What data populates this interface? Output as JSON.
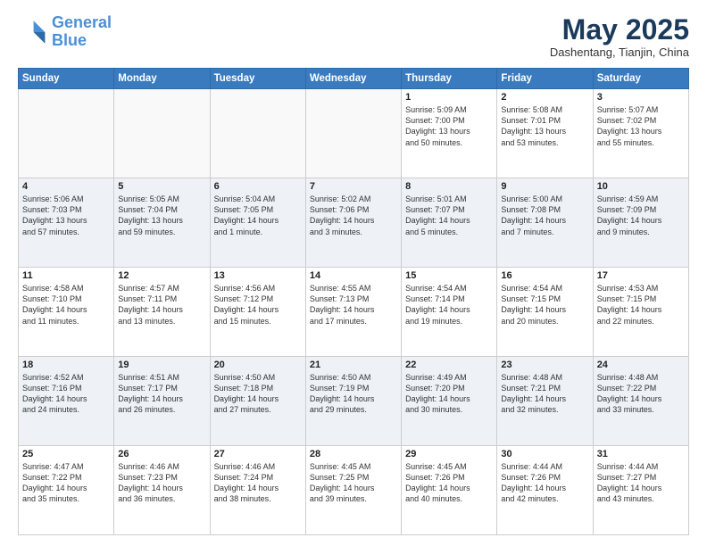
{
  "header": {
    "logo_line1": "General",
    "logo_line2": "Blue",
    "month": "May 2025",
    "location": "Dashentang, Tianjin, China"
  },
  "weekdays": [
    "Sunday",
    "Monday",
    "Tuesday",
    "Wednesday",
    "Thursday",
    "Friday",
    "Saturday"
  ],
  "weeks": [
    [
      {
        "day": "",
        "content": ""
      },
      {
        "day": "",
        "content": ""
      },
      {
        "day": "",
        "content": ""
      },
      {
        "day": "",
        "content": ""
      },
      {
        "day": "1",
        "content": "Sunrise: 5:09 AM\nSunset: 7:00 PM\nDaylight: 13 hours\nand 50 minutes."
      },
      {
        "day": "2",
        "content": "Sunrise: 5:08 AM\nSunset: 7:01 PM\nDaylight: 13 hours\nand 53 minutes."
      },
      {
        "day": "3",
        "content": "Sunrise: 5:07 AM\nSunset: 7:02 PM\nDaylight: 13 hours\nand 55 minutes."
      }
    ],
    [
      {
        "day": "4",
        "content": "Sunrise: 5:06 AM\nSunset: 7:03 PM\nDaylight: 13 hours\nand 57 minutes."
      },
      {
        "day": "5",
        "content": "Sunrise: 5:05 AM\nSunset: 7:04 PM\nDaylight: 13 hours\nand 59 minutes."
      },
      {
        "day": "6",
        "content": "Sunrise: 5:04 AM\nSunset: 7:05 PM\nDaylight: 14 hours\nand 1 minute."
      },
      {
        "day": "7",
        "content": "Sunrise: 5:02 AM\nSunset: 7:06 PM\nDaylight: 14 hours\nand 3 minutes."
      },
      {
        "day": "8",
        "content": "Sunrise: 5:01 AM\nSunset: 7:07 PM\nDaylight: 14 hours\nand 5 minutes."
      },
      {
        "day": "9",
        "content": "Sunrise: 5:00 AM\nSunset: 7:08 PM\nDaylight: 14 hours\nand 7 minutes."
      },
      {
        "day": "10",
        "content": "Sunrise: 4:59 AM\nSunset: 7:09 PM\nDaylight: 14 hours\nand 9 minutes."
      }
    ],
    [
      {
        "day": "11",
        "content": "Sunrise: 4:58 AM\nSunset: 7:10 PM\nDaylight: 14 hours\nand 11 minutes."
      },
      {
        "day": "12",
        "content": "Sunrise: 4:57 AM\nSunset: 7:11 PM\nDaylight: 14 hours\nand 13 minutes."
      },
      {
        "day": "13",
        "content": "Sunrise: 4:56 AM\nSunset: 7:12 PM\nDaylight: 14 hours\nand 15 minutes."
      },
      {
        "day": "14",
        "content": "Sunrise: 4:55 AM\nSunset: 7:13 PM\nDaylight: 14 hours\nand 17 minutes."
      },
      {
        "day": "15",
        "content": "Sunrise: 4:54 AM\nSunset: 7:14 PM\nDaylight: 14 hours\nand 19 minutes."
      },
      {
        "day": "16",
        "content": "Sunrise: 4:54 AM\nSunset: 7:15 PM\nDaylight: 14 hours\nand 20 minutes."
      },
      {
        "day": "17",
        "content": "Sunrise: 4:53 AM\nSunset: 7:15 PM\nDaylight: 14 hours\nand 22 minutes."
      }
    ],
    [
      {
        "day": "18",
        "content": "Sunrise: 4:52 AM\nSunset: 7:16 PM\nDaylight: 14 hours\nand 24 minutes."
      },
      {
        "day": "19",
        "content": "Sunrise: 4:51 AM\nSunset: 7:17 PM\nDaylight: 14 hours\nand 26 minutes."
      },
      {
        "day": "20",
        "content": "Sunrise: 4:50 AM\nSunset: 7:18 PM\nDaylight: 14 hours\nand 27 minutes."
      },
      {
        "day": "21",
        "content": "Sunrise: 4:50 AM\nSunset: 7:19 PM\nDaylight: 14 hours\nand 29 minutes."
      },
      {
        "day": "22",
        "content": "Sunrise: 4:49 AM\nSunset: 7:20 PM\nDaylight: 14 hours\nand 30 minutes."
      },
      {
        "day": "23",
        "content": "Sunrise: 4:48 AM\nSunset: 7:21 PM\nDaylight: 14 hours\nand 32 minutes."
      },
      {
        "day": "24",
        "content": "Sunrise: 4:48 AM\nSunset: 7:22 PM\nDaylight: 14 hours\nand 33 minutes."
      }
    ],
    [
      {
        "day": "25",
        "content": "Sunrise: 4:47 AM\nSunset: 7:22 PM\nDaylight: 14 hours\nand 35 minutes."
      },
      {
        "day": "26",
        "content": "Sunrise: 4:46 AM\nSunset: 7:23 PM\nDaylight: 14 hours\nand 36 minutes."
      },
      {
        "day": "27",
        "content": "Sunrise: 4:46 AM\nSunset: 7:24 PM\nDaylight: 14 hours\nand 38 minutes."
      },
      {
        "day": "28",
        "content": "Sunrise: 4:45 AM\nSunset: 7:25 PM\nDaylight: 14 hours\nand 39 minutes."
      },
      {
        "day": "29",
        "content": "Sunrise: 4:45 AM\nSunset: 7:26 PM\nDaylight: 14 hours\nand 40 minutes."
      },
      {
        "day": "30",
        "content": "Sunrise: 4:44 AM\nSunset: 7:26 PM\nDaylight: 14 hours\nand 42 minutes."
      },
      {
        "day": "31",
        "content": "Sunrise: 4:44 AM\nSunset: 7:27 PM\nDaylight: 14 hours\nand 43 minutes."
      }
    ]
  ]
}
